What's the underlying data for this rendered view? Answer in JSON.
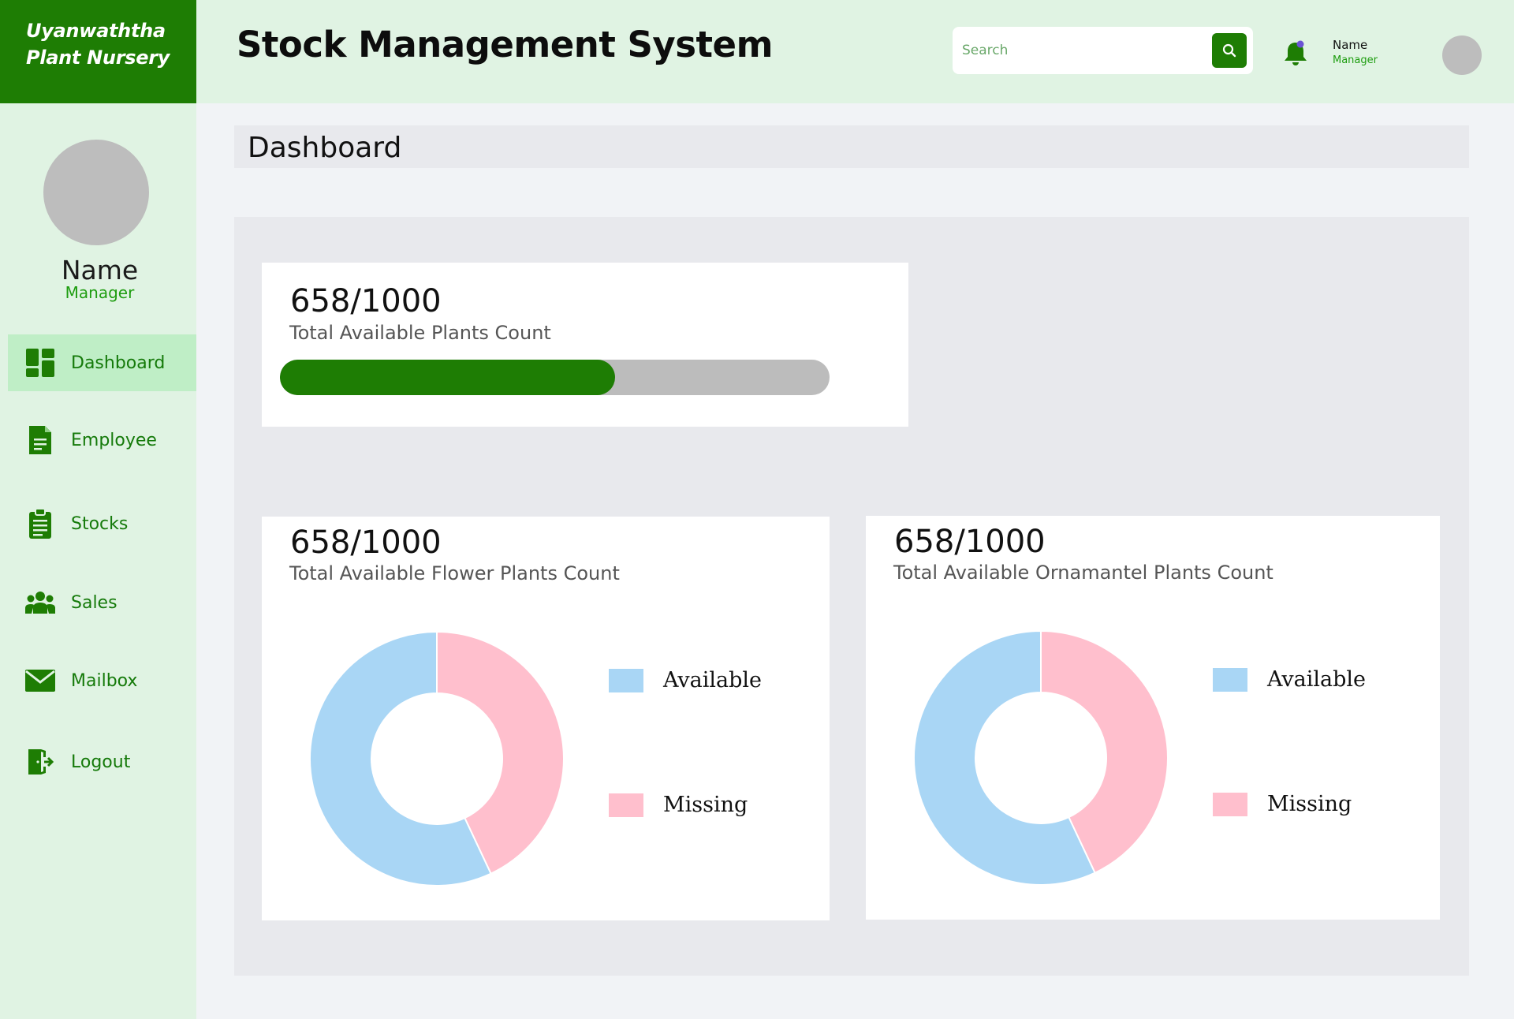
{
  "brand": {
    "line1": "Uyanwaththa",
    "line2": "Plant Nursery"
  },
  "header": {
    "title": "Stock Management System",
    "search_placeholder": "Search",
    "user_name": "Name",
    "user_role": "Manager"
  },
  "sidebar": {
    "profile_name": "Name",
    "profile_role": "Manager",
    "items": [
      {
        "label": "Dashboard",
        "icon": "dashboard-icon",
        "active": true
      },
      {
        "label": "Employee",
        "icon": "document-icon"
      },
      {
        "label": "Stocks",
        "icon": "clipboard-icon"
      },
      {
        "label": "Sales",
        "icon": "people-icon"
      },
      {
        "label": "Mailbox",
        "icon": "mail-icon"
      },
      {
        "label": "Logout",
        "icon": "logout-icon"
      }
    ]
  },
  "page": {
    "title": "Dashboard"
  },
  "cards": {
    "total": {
      "count": "658/1000",
      "label": "Total Available Plants Count",
      "progress": 0.61
    },
    "flower": {
      "count": "658/1000",
      "label": "Total Available Flower Plants Count"
    },
    "ornamental": {
      "count": "658/1000",
      "label": "Total Available Ornamantel Plants Count"
    }
  },
  "legend": {
    "available": "Available",
    "missing": "Missing"
  },
  "colors": {
    "brand_green": "#1e7d04",
    "available": "#a9d6f5",
    "missing": "#ffbfcd"
  },
  "chart_data": [
    {
      "type": "pie",
      "categories": [
        "Available",
        "Missing"
      ],
      "values": [
        57,
        43
      ]
    },
    {
      "type": "pie",
      "categories": [
        "Available",
        "Missing"
      ],
      "values": [
        57,
        43
      ]
    }
  ]
}
